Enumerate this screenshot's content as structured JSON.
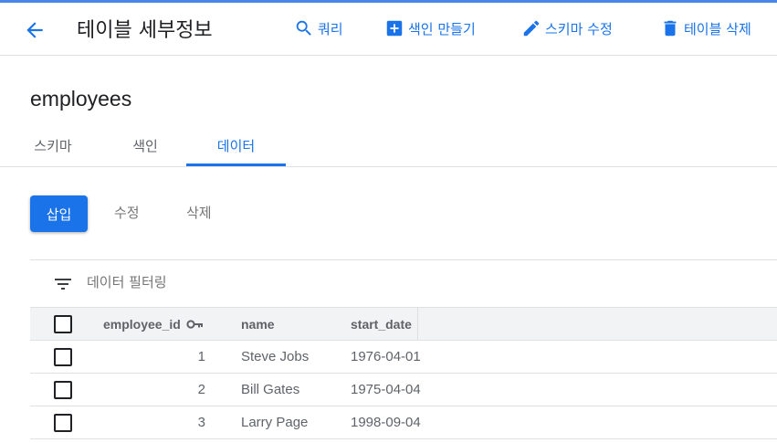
{
  "header": {
    "title": "테이블 세부정보",
    "actions": [
      {
        "label": "쿼리",
        "icon": "search-icon"
      },
      {
        "label": "색인 만들기",
        "icon": "add-box-icon"
      },
      {
        "label": "스키마 수정",
        "icon": "pencil-icon"
      },
      {
        "label": "테이블 삭제",
        "icon": "trash-icon"
      }
    ],
    "accent_color": "#1a73e8"
  },
  "table_name": "employees",
  "tabs": [
    {
      "label": "스키마",
      "active": false
    },
    {
      "label": "색인",
      "active": false
    },
    {
      "label": "데이터",
      "active": true
    }
  ],
  "toolbar": {
    "insert": "삽입",
    "edit": "수정",
    "delete": "삭제"
  },
  "filter": {
    "placeholder": "데이터 필터링"
  },
  "grid": {
    "columns": [
      "employee_id",
      "name",
      "start_date"
    ],
    "primary_key_column": "employee_id",
    "rows": [
      {
        "employee_id": "1",
        "name": "Steve Jobs",
        "start_date": "1976-04-01"
      },
      {
        "employee_id": "2",
        "name": "Bill Gates",
        "start_date": "1975-04-04"
      },
      {
        "employee_id": "3",
        "name": "Larry Page",
        "start_date": "1998-09-04"
      }
    ]
  }
}
